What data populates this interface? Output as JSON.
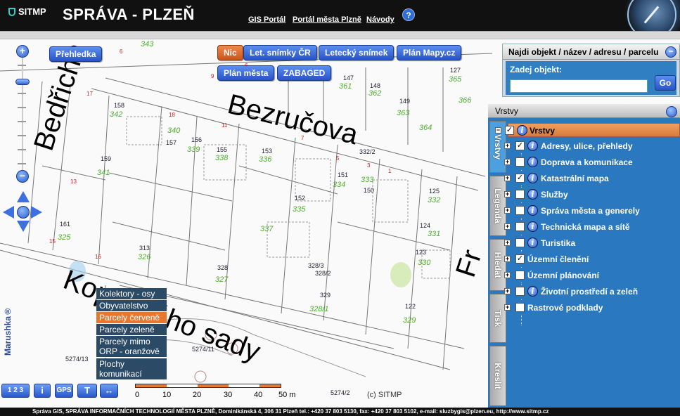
{
  "header": {
    "logo": "SITMP",
    "title": "SPRÁVA - PLZEŇ",
    "links": [
      "GIS Portál",
      "Portál města Plzně",
      "Návody"
    ],
    "help": "?"
  },
  "map": {
    "streets": [
      "Bedřicha",
      "Bezručova",
      "Kopeckého sady",
      "Fr"
    ],
    "buttons_row1": [
      "Nic",
      "Let. snímky ČR",
      "Letecký snímek",
      "Plán Mapy.cz"
    ],
    "buttons_row2": [
      "Plán města",
      "ZABAGED"
    ],
    "overview_button": "Přehledka",
    "zoom_in": "+",
    "zoom_out": "−",
    "legend": [
      "Kolektory - osy",
      "Obyvatelstvo",
      "Parcely červeně",
      "Parcely zeleně",
      "Parcely mimo ORP - oranžově",
      "Plochy komunikací"
    ],
    "scale_labels": [
      "0",
      "10",
      "20",
      "30",
      "40",
      "50 m"
    ],
    "copyright": "(c) SITMP",
    "watermark": "Marushka®",
    "tools": [
      "1 2 3",
      "i",
      "GPS",
      "T",
      "↔"
    ],
    "parcel_numbers_green": [
      "343",
      "342",
      "340",
      "339",
      "338",
      "336",
      "341",
      "325",
      "326",
      "327",
      "335",
      "337",
      "334",
      "333",
      "332",
      "331",
      "330",
      "329",
      "328/1",
      "361",
      "362",
      "363",
      "364",
      "365",
      "366"
    ],
    "parcel_numbers_black": [
      "158",
      "157",
      "156",
      "155",
      "153",
      "159",
      "161",
      "313",
      "328",
      "152",
      "151",
      "150",
      "125",
      "124",
      "123",
      "122",
      "147",
      "148",
      "149",
      "127",
      "329",
      "5274/13",
      "5274/11",
      "5274/2",
      "328/3",
      "328/2",
      "332/2"
    ]
  },
  "search": {
    "title": "Najdi objekt / název / adresu / parcelu",
    "label": "Zadej objekt:",
    "value": "",
    "go": "Go",
    "collapse": "−"
  },
  "layers": {
    "title": "Vrstvy",
    "tabs": [
      "Vrstvy",
      "Legenda",
      "Hledat",
      "Tisk",
      "Kreslit"
    ],
    "root": {
      "label": "Vrstvy",
      "checked": true
    },
    "items": [
      {
        "label": "Adresy, ulice, přehledy",
        "checked": true,
        "info": true
      },
      {
        "label": "Doprava a komunikace",
        "checked": false,
        "info": true
      },
      {
        "label": "Katastrální mapa",
        "checked": true,
        "info": true
      },
      {
        "label": "Služby",
        "checked": false,
        "info": true
      },
      {
        "label": "Správa města a generely",
        "checked": false,
        "info": true
      },
      {
        "label": "Technická mapa a sítě",
        "checked": false,
        "info": true
      },
      {
        "label": "Turistika",
        "checked": false,
        "info": true
      },
      {
        "label": "Územní členění",
        "checked": true,
        "info": false
      },
      {
        "label": "Územní plánování",
        "checked": false,
        "info": false
      },
      {
        "label": "Životní prostředí a zeleň",
        "checked": false,
        "info": true
      },
      {
        "label": "Rastrové podklady",
        "checked": false,
        "info": false
      }
    ]
  },
  "footer": "Správa GIS, SPRÁVA INFORMAČNÍCH TECHNOLOGIÍ MĚSTA PLZNĚ, Dominikánská 4, 306 31 Plzeň tel.: +420 37 803 5130, fax: +420 37 803 5102, e-mail:    sluzbygis@plzen.eu,    http://www.sitmp.cz",
  "colors": {
    "header": "#111111",
    "panel": "#2a78bf",
    "button": "#2853c7",
    "active_button": "#c9561c",
    "parcel_green": "#4caf2a",
    "parcel_red": "#cc2222"
  }
}
